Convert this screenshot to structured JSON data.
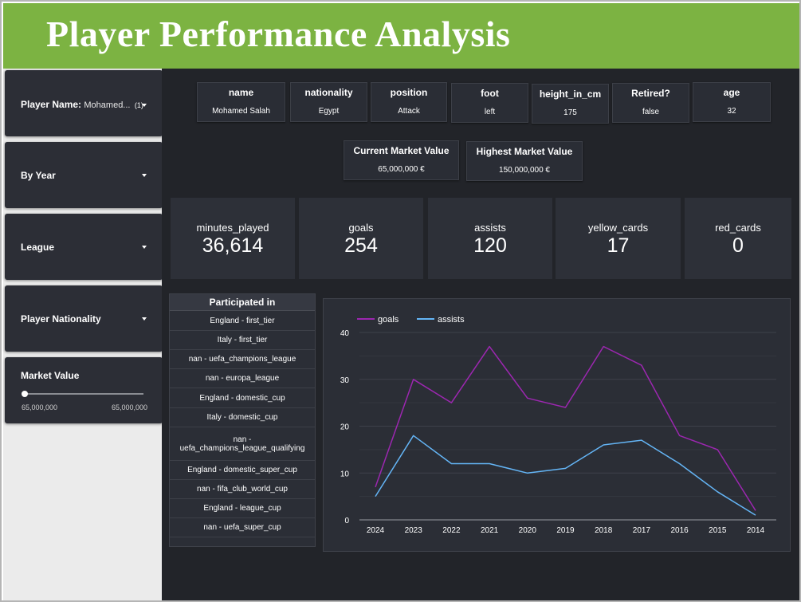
{
  "header": {
    "title": "Player Performance Analysis"
  },
  "filters": {
    "player_name": {
      "label": "Player Name:",
      "value": "Mohamed...",
      "count": "(1)"
    },
    "by_year": {
      "label": "By Year"
    },
    "league": {
      "label": "League"
    },
    "nationality": {
      "label": "Player Nationality"
    },
    "market_value": {
      "label": "Market Value",
      "min": "65,000,000",
      "max": "65,000,000"
    }
  },
  "player_info": [
    {
      "header": "name",
      "value": "Mohamed Salah"
    },
    {
      "header": "nationality",
      "value": "Egypt"
    },
    {
      "header": "position",
      "value": "Attack"
    },
    {
      "header": "foot",
      "value": "left"
    },
    {
      "header": "height_in_cm",
      "value": "175"
    },
    {
      "header": "Retired?",
      "value": "false"
    },
    {
      "header": "age",
      "value": "32"
    }
  ],
  "market_values": [
    {
      "header": "Current Market Value",
      "value": "65,000,000 €"
    },
    {
      "header": "Highest Market Value",
      "value": "150,000,000 €"
    }
  ],
  "kpis": [
    {
      "label": "minutes_played",
      "value": "36,614"
    },
    {
      "label": "goals",
      "value": "254"
    },
    {
      "label": "assists",
      "value": "120"
    },
    {
      "label": "yellow_cards",
      "value": "17"
    },
    {
      "label": "red_cards",
      "value": "0"
    }
  ],
  "participated": {
    "header": "Participated in",
    "rows": [
      "England - first_tier",
      "Italy - first_tier",
      "nan - uefa_champions_league",
      "nan - europa_league",
      "England - domestic_cup",
      "Italy - domestic_cup",
      "nan - uefa_champions_league_qualifying",
      "England - domestic_super_cup",
      "nan - fifa_club_world_cup",
      "England - league_cup",
      "nan - uefa_super_cup"
    ]
  },
  "colors": {
    "header_bg": "#7cb342",
    "goals_line": "#9c27b0",
    "assists_line": "#64b5f6",
    "dashboard_bg": "#222429"
  },
  "chart_data": {
    "type": "line",
    "x": [
      "2024",
      "2023",
      "2022",
      "2021",
      "2020",
      "2019",
      "2018",
      "2017",
      "2016",
      "2015",
      "2014"
    ],
    "series": [
      {
        "name": "goals",
        "values": [
          7,
          30,
          25,
          37,
          26,
          24,
          37,
          33,
          18,
          15,
          2
        ],
        "color": "#9c27b0"
      },
      {
        "name": "assists",
        "values": [
          5,
          18,
          12,
          12,
          10,
          11,
          16,
          17,
          12,
          6,
          1
        ],
        "color": "#64b5f6"
      }
    ],
    "yticks": [
      0,
      10,
      20,
      30,
      40
    ],
    "ylim": [
      0,
      40
    ],
    "grid": true,
    "legend": "top-left"
  }
}
